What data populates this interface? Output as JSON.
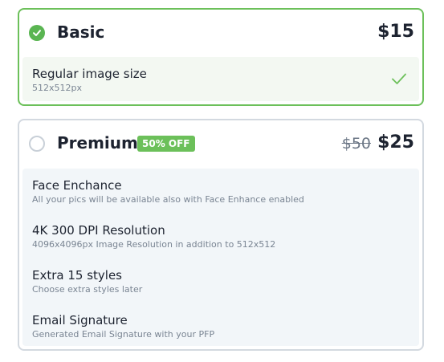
{
  "plans": {
    "basic": {
      "name": "Basic",
      "price": "$15",
      "selected": true,
      "features": [
        {
          "title": "Regular image size",
          "subtitle": "512x512px"
        }
      ]
    },
    "premium": {
      "name": "Premium",
      "badge": "50% OFF",
      "old_price": "$50",
      "price": "$25",
      "selected": false,
      "features": [
        {
          "title": "Face Enchance",
          "subtitle": "All your pics will be available also with Face Enhance enabled"
        },
        {
          "title": "4K 300 DPI Resolution",
          "subtitle": "4096x4096px Image Resolution in addition to 512x512"
        },
        {
          "title": "Extra 15 styles",
          "subtitle": "Choose extra styles later"
        },
        {
          "title": "Email Signature",
          "subtitle": "Generated Email Signature with your PFP"
        }
      ]
    }
  },
  "icons": {
    "selected_radio": "check-circle-icon",
    "unselected_radio": "radio-empty-icon",
    "included": "check-icon"
  },
  "colors": {
    "accent_green": "#6cc05a",
    "selected_border": "#6cc05a",
    "unselected_border": "#d3d9e0",
    "text_dark": "#1d2330",
    "text_muted": "#7a8593"
  }
}
